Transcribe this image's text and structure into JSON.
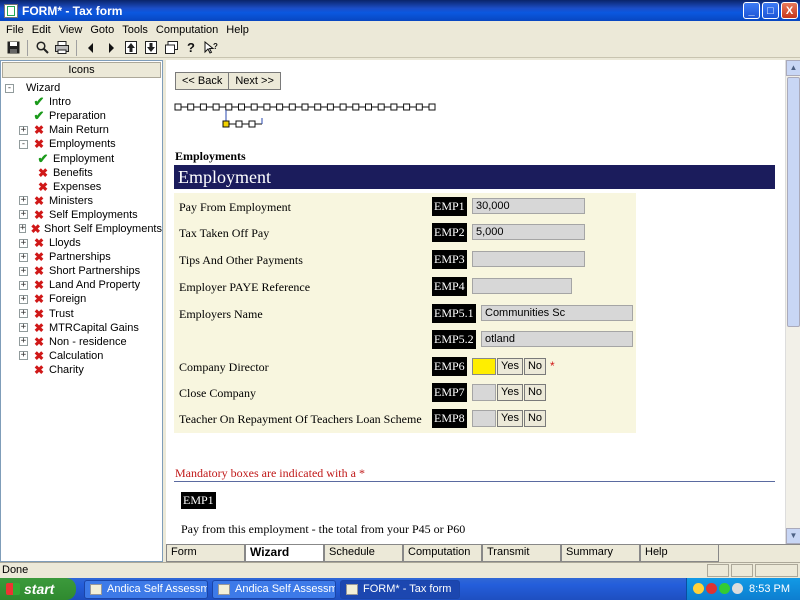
{
  "window": {
    "title": "FORM* - Tax form",
    "controls": [
      "_",
      "□",
      "X"
    ]
  },
  "menu": [
    "File",
    "Edit",
    "View",
    "Goto",
    "Tools",
    "Computation",
    "Help"
  ],
  "toolbar_icons": [
    "save-icon",
    "zoom-icon",
    "print-icon",
    "prev-icon",
    "next-icon",
    "upload-icon",
    "download-icon",
    "window-icon",
    "help-icon",
    "context-help-icon"
  ],
  "left_panel": {
    "header": "Icons",
    "tree": [
      {
        "label": "Wizard",
        "expander": "-",
        "status": "none",
        "indent": 0
      },
      {
        "label": "Intro",
        "expander": "",
        "status": "check",
        "indent": 1
      },
      {
        "label": "Preparation",
        "expander": "",
        "status": "check",
        "indent": 1
      },
      {
        "label": "Main Return",
        "expander": "+",
        "status": "cross",
        "indent": 1
      },
      {
        "label": "Employments",
        "expander": "-",
        "status": "cross",
        "indent": 1
      },
      {
        "label": "Employment",
        "expander": "",
        "status": "check",
        "indent": 2
      },
      {
        "label": "Benefits",
        "expander": "",
        "status": "cross",
        "indent": 2
      },
      {
        "label": "Expenses",
        "expander": "",
        "status": "cross",
        "indent": 2
      },
      {
        "label": "Ministers",
        "expander": "+",
        "status": "cross",
        "indent": 1
      },
      {
        "label": "Self Employments",
        "expander": "+",
        "status": "cross",
        "indent": 1
      },
      {
        "label": "Short Self Employments",
        "expander": "+",
        "status": "cross",
        "indent": 1
      },
      {
        "label": "Lloyds",
        "expander": "+",
        "status": "cross",
        "indent": 1
      },
      {
        "label": "Partnerships",
        "expander": "+",
        "status": "cross",
        "indent": 1
      },
      {
        "label": "Short Partnerships",
        "expander": "+",
        "status": "cross",
        "indent": 1
      },
      {
        "label": "Land And Property",
        "expander": "+",
        "status": "cross",
        "indent": 1
      },
      {
        "label": "Foreign",
        "expander": "+",
        "status": "cross",
        "indent": 1
      },
      {
        "label": "Trust",
        "expander": "+",
        "status": "cross",
        "indent": 1
      },
      {
        "label": "MTRCapital Gains",
        "expander": "+",
        "status": "cross",
        "indent": 1
      },
      {
        "label": "Non - residence",
        "expander": "+",
        "status": "cross",
        "indent": 1
      },
      {
        "label": "Calculation",
        "expander": "+",
        "status": "cross",
        "indent": 1
      },
      {
        "label": "Charity",
        "expander": "",
        "status": "cross",
        "indent": 1
      }
    ]
  },
  "nav": {
    "back": "<< Back",
    "next": "Next >>"
  },
  "section": {
    "heading": "Employments",
    "banner": "Employment"
  },
  "form": {
    "rows": [
      {
        "label": "Pay From Employment",
        "code": "EMP1",
        "value": "30,000",
        "kind": "text"
      },
      {
        "label": "Tax Taken Off Pay",
        "code": "EMP2",
        "value": "5,000",
        "kind": "text"
      },
      {
        "label": "Tips And Other Payments",
        "code": "EMP3",
        "value": "",
        "kind": "text"
      },
      {
        "label": "Employer PAYE Reference",
        "code": "EMP4",
        "value": "",
        "kind": "text"
      },
      {
        "label": "Employers Name",
        "code": "EMP5.1",
        "value": "Communities Sc",
        "kind": "text"
      },
      {
        "label": "",
        "code": "EMP5.2",
        "value": "otland",
        "kind": "text"
      },
      {
        "label": "Company Director",
        "code": "EMP6",
        "value": "",
        "kind": "yesno",
        "mandatory": true
      },
      {
        "label": "Close Company",
        "code": "EMP7",
        "value": "",
        "kind": "yesno"
      },
      {
        "label": "Teacher On Repayment Of Teachers Loan Scheme",
        "code": "EMP8",
        "value": "",
        "kind": "yesno"
      }
    ],
    "yes": "Yes",
    "no": "No",
    "star": "*"
  },
  "mandatory_note": "Mandatory boxes are indicated with a *",
  "help": {
    "code": "EMP1",
    "text": "Pay from this employment - the total from your P45 or P60"
  },
  "bottom_tabs": [
    {
      "label": "Form",
      "active": false
    },
    {
      "label": "Wizard",
      "active": true
    },
    {
      "label": "Schedule",
      "active": false
    },
    {
      "label": "Computation",
      "active": false
    },
    {
      "label": "Transmit",
      "active": false
    },
    {
      "label": "Summary",
      "active": false
    },
    {
      "label": "Help",
      "active": false
    }
  ],
  "status": "Done",
  "taskbar": {
    "start": "start",
    "buttons": [
      "Andica Self Assessme...",
      "Andica Self Assessme...",
      "FORM* - Tax form"
    ],
    "clock": "8:53 PM"
  },
  "colors": {
    "banner": "#1b1c5c",
    "check": "#1b9a1b",
    "cross": "#d01818",
    "mandatory_text": "#c01818"
  }
}
